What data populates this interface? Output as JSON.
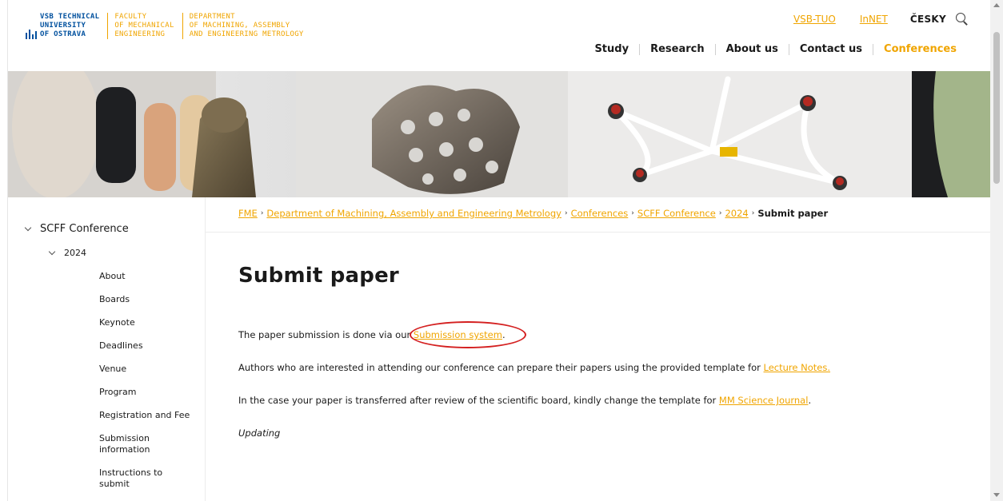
{
  "header": {
    "logo": {
      "vsb": [
        "VSB TECHNICAL",
        "UNIVERSITY",
        "OF OSTRAVA"
      ],
      "faculty": [
        "FACULTY",
        "OF MECHANICAL",
        "ENGINEERING"
      ],
      "department": [
        "DEPARTMENT",
        "OF MACHINING, ASSEMBLY",
        "AND ENGINEERING METROLOGY"
      ]
    },
    "top_links": [
      "VSB-TUO",
      "InNET"
    ],
    "language": "ČESKY",
    "nav": [
      "Study",
      "Research",
      "About us",
      "Contact us",
      "Conferences"
    ],
    "active_nav": "Conferences"
  },
  "sidebar": {
    "root": "SCFF Conference",
    "year": "2024",
    "items": [
      "About",
      "Boards",
      "Keynote",
      "Deadlines",
      "Venue",
      "Program",
      "Registration and Fee",
      "Submission information",
      "Instructions to submit"
    ]
  },
  "breadcrumb": {
    "links": [
      "FME",
      "Department of Machining, Assembly and Engineering Metrology",
      "Conferences",
      "SCFF Conference",
      "2024"
    ],
    "current": "Submit paper",
    "separator": "›"
  },
  "content": {
    "title": "Submit paper",
    "p1_text": "The paper submission is done via our ",
    "p1_link": "Submission system",
    "p1_end": ".",
    "p2_text": "Authors who are interested in attending our conference can prepare their papers using the provided template for ",
    "p2_link": "Lecture Notes.",
    "p3_text": "In the case your paper is transferred after review of the scientific board, kindly change the template for ",
    "p3_link": "MM Science Journal",
    "p3_end": ".",
    "p4": "Updating"
  },
  "colors": {
    "accent": "#f0a500",
    "brand_blue": "#00509e",
    "highlight": "#d42020"
  }
}
